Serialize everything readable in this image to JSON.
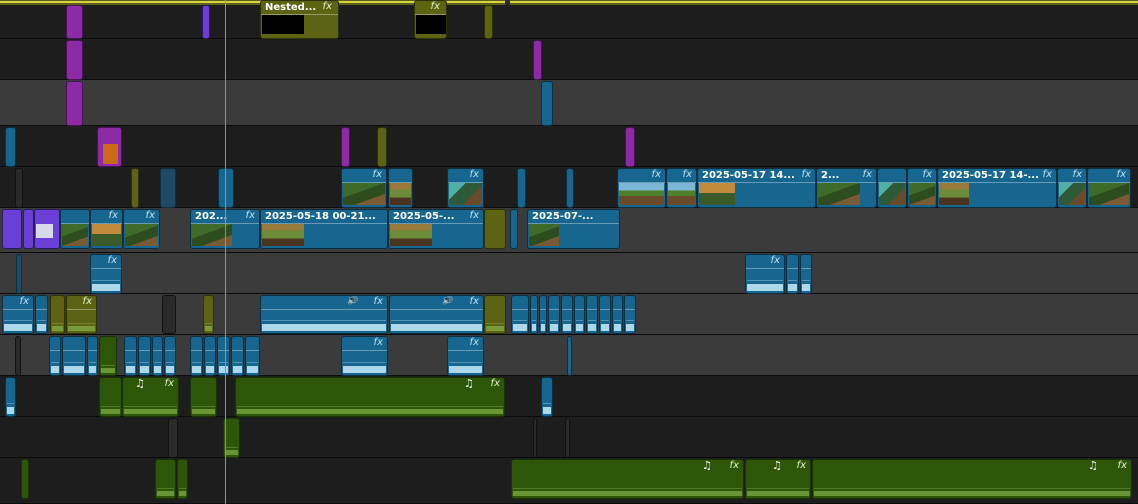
{
  "timeline": {
    "clip_labels": {
      "nested": "Nested...",
      "v3_a": "2025-05-17 14...",
      "v3_b": "2...",
      "v3_c": "2025-05-17 14-...",
      "v2_a": "202...",
      "v2_b": "2025-05-18 00-21...",
      "v2_c": "2025-05-...",
      "v2_d": "2025-07-..."
    },
    "effect_badge": "fx",
    "music_icon": "♫",
    "voice_icon": "🔊",
    "colors": {
      "video_clip": "#16668f",
      "audio_clip_green": "#2e5609",
      "nested_clip": "#5c6414",
      "adjustment_clip": "#8e2aa6",
      "playhead": "#4ea0ff",
      "ruler": "#d6d63a"
    }
  }
}
